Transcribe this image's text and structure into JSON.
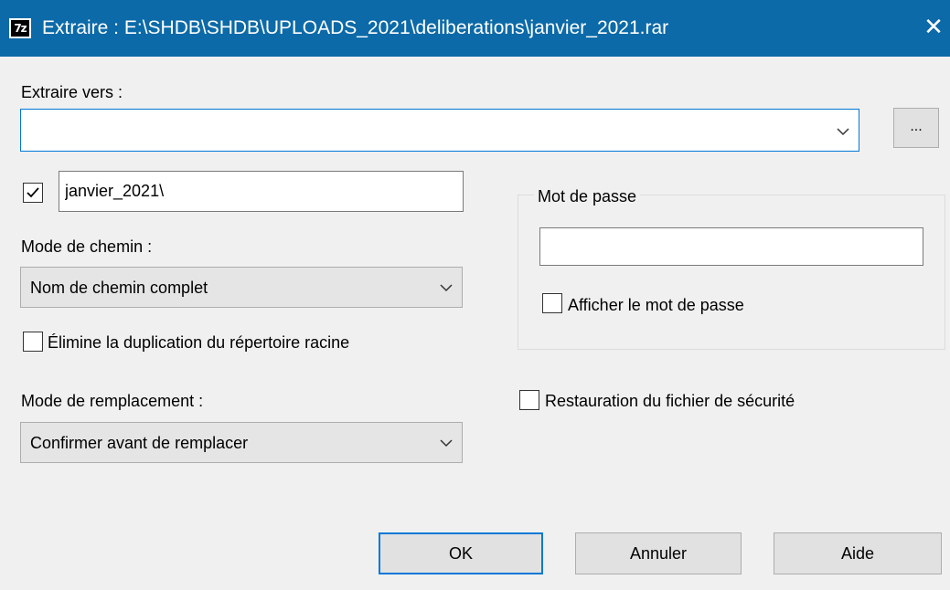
{
  "window": {
    "app_icon_text": "7z",
    "title": "Extraire : E:\\SHDB\\SHDB\\UPLOADS_2021\\deliberations\\janvier_2021.rar",
    "close_glyph": "✕"
  },
  "extract_to": {
    "label": "Extraire vers :",
    "value": "",
    "browse_label": "..."
  },
  "folder": {
    "checked": true,
    "value": "janvier_2021\\"
  },
  "path_mode": {
    "label": "Mode de chemin :",
    "selected": "Nom de chemin complet"
  },
  "eliminate_duplication": {
    "label": "Élimine la duplication du répertoire racine",
    "checked": false
  },
  "overwrite_mode": {
    "label": "Mode de remplacement :",
    "selected": "Confirmer avant de remplacer"
  },
  "password": {
    "group_title": "Mot de passe",
    "value": "",
    "show_label": "Afficher le mot de passe",
    "show_checked": false
  },
  "restore_security": {
    "label": "Restauration du fichier de sécurité",
    "checked": false
  },
  "buttons": {
    "ok": "OK",
    "cancel": "Annuler",
    "help": "Aide"
  },
  "colors": {
    "titlebar": "#0c6aa8",
    "focus": "#0078d7"
  }
}
